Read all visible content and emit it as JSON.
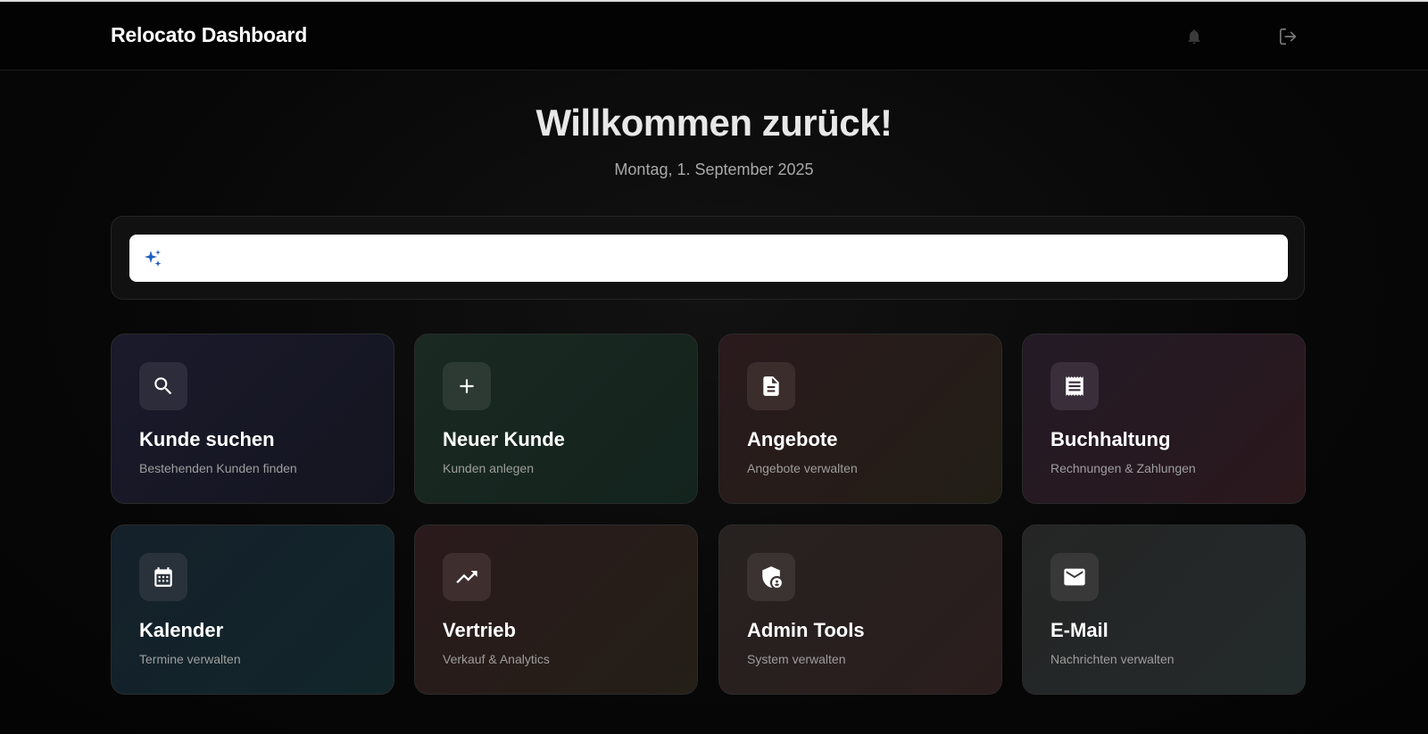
{
  "header": {
    "brand": "Relocato Dashboard",
    "notifications_icon": "bell-icon",
    "logout_icon": "logout-icon"
  },
  "welcome": {
    "title": "Willkommen zurück!",
    "date": "Montag, 1. September 2025"
  },
  "search": {
    "icon": "sparkle-icon",
    "placeholder": "",
    "value": ""
  },
  "colors": {
    "background": "#060606",
    "sparkle_accent": "#1e5fc0"
  },
  "cards": [
    {
      "title": "Kunde suchen",
      "subtitle": "Bestehenden Kunden finden",
      "icon": "search-icon"
    },
    {
      "title": "Neuer Kunde",
      "subtitle": "Kunden anlegen",
      "icon": "plus-icon"
    },
    {
      "title": "Angebote",
      "subtitle": "Angebote verwalten",
      "icon": "document-icon"
    },
    {
      "title": "Buchhaltung",
      "subtitle": "Rechnungen & Zahlungen",
      "icon": "receipt-icon"
    },
    {
      "title": "Kalender",
      "subtitle": "Termine verwalten",
      "icon": "calendar-icon"
    },
    {
      "title": "Vertrieb",
      "subtitle": "Verkauf & Analytics",
      "icon": "trending-up-icon"
    },
    {
      "title": "Admin Tools",
      "subtitle": "System verwalten",
      "icon": "admin-shield-icon"
    },
    {
      "title": "E-Mail",
      "subtitle": "Nachrichten verwalten",
      "icon": "mail-icon"
    }
  ]
}
